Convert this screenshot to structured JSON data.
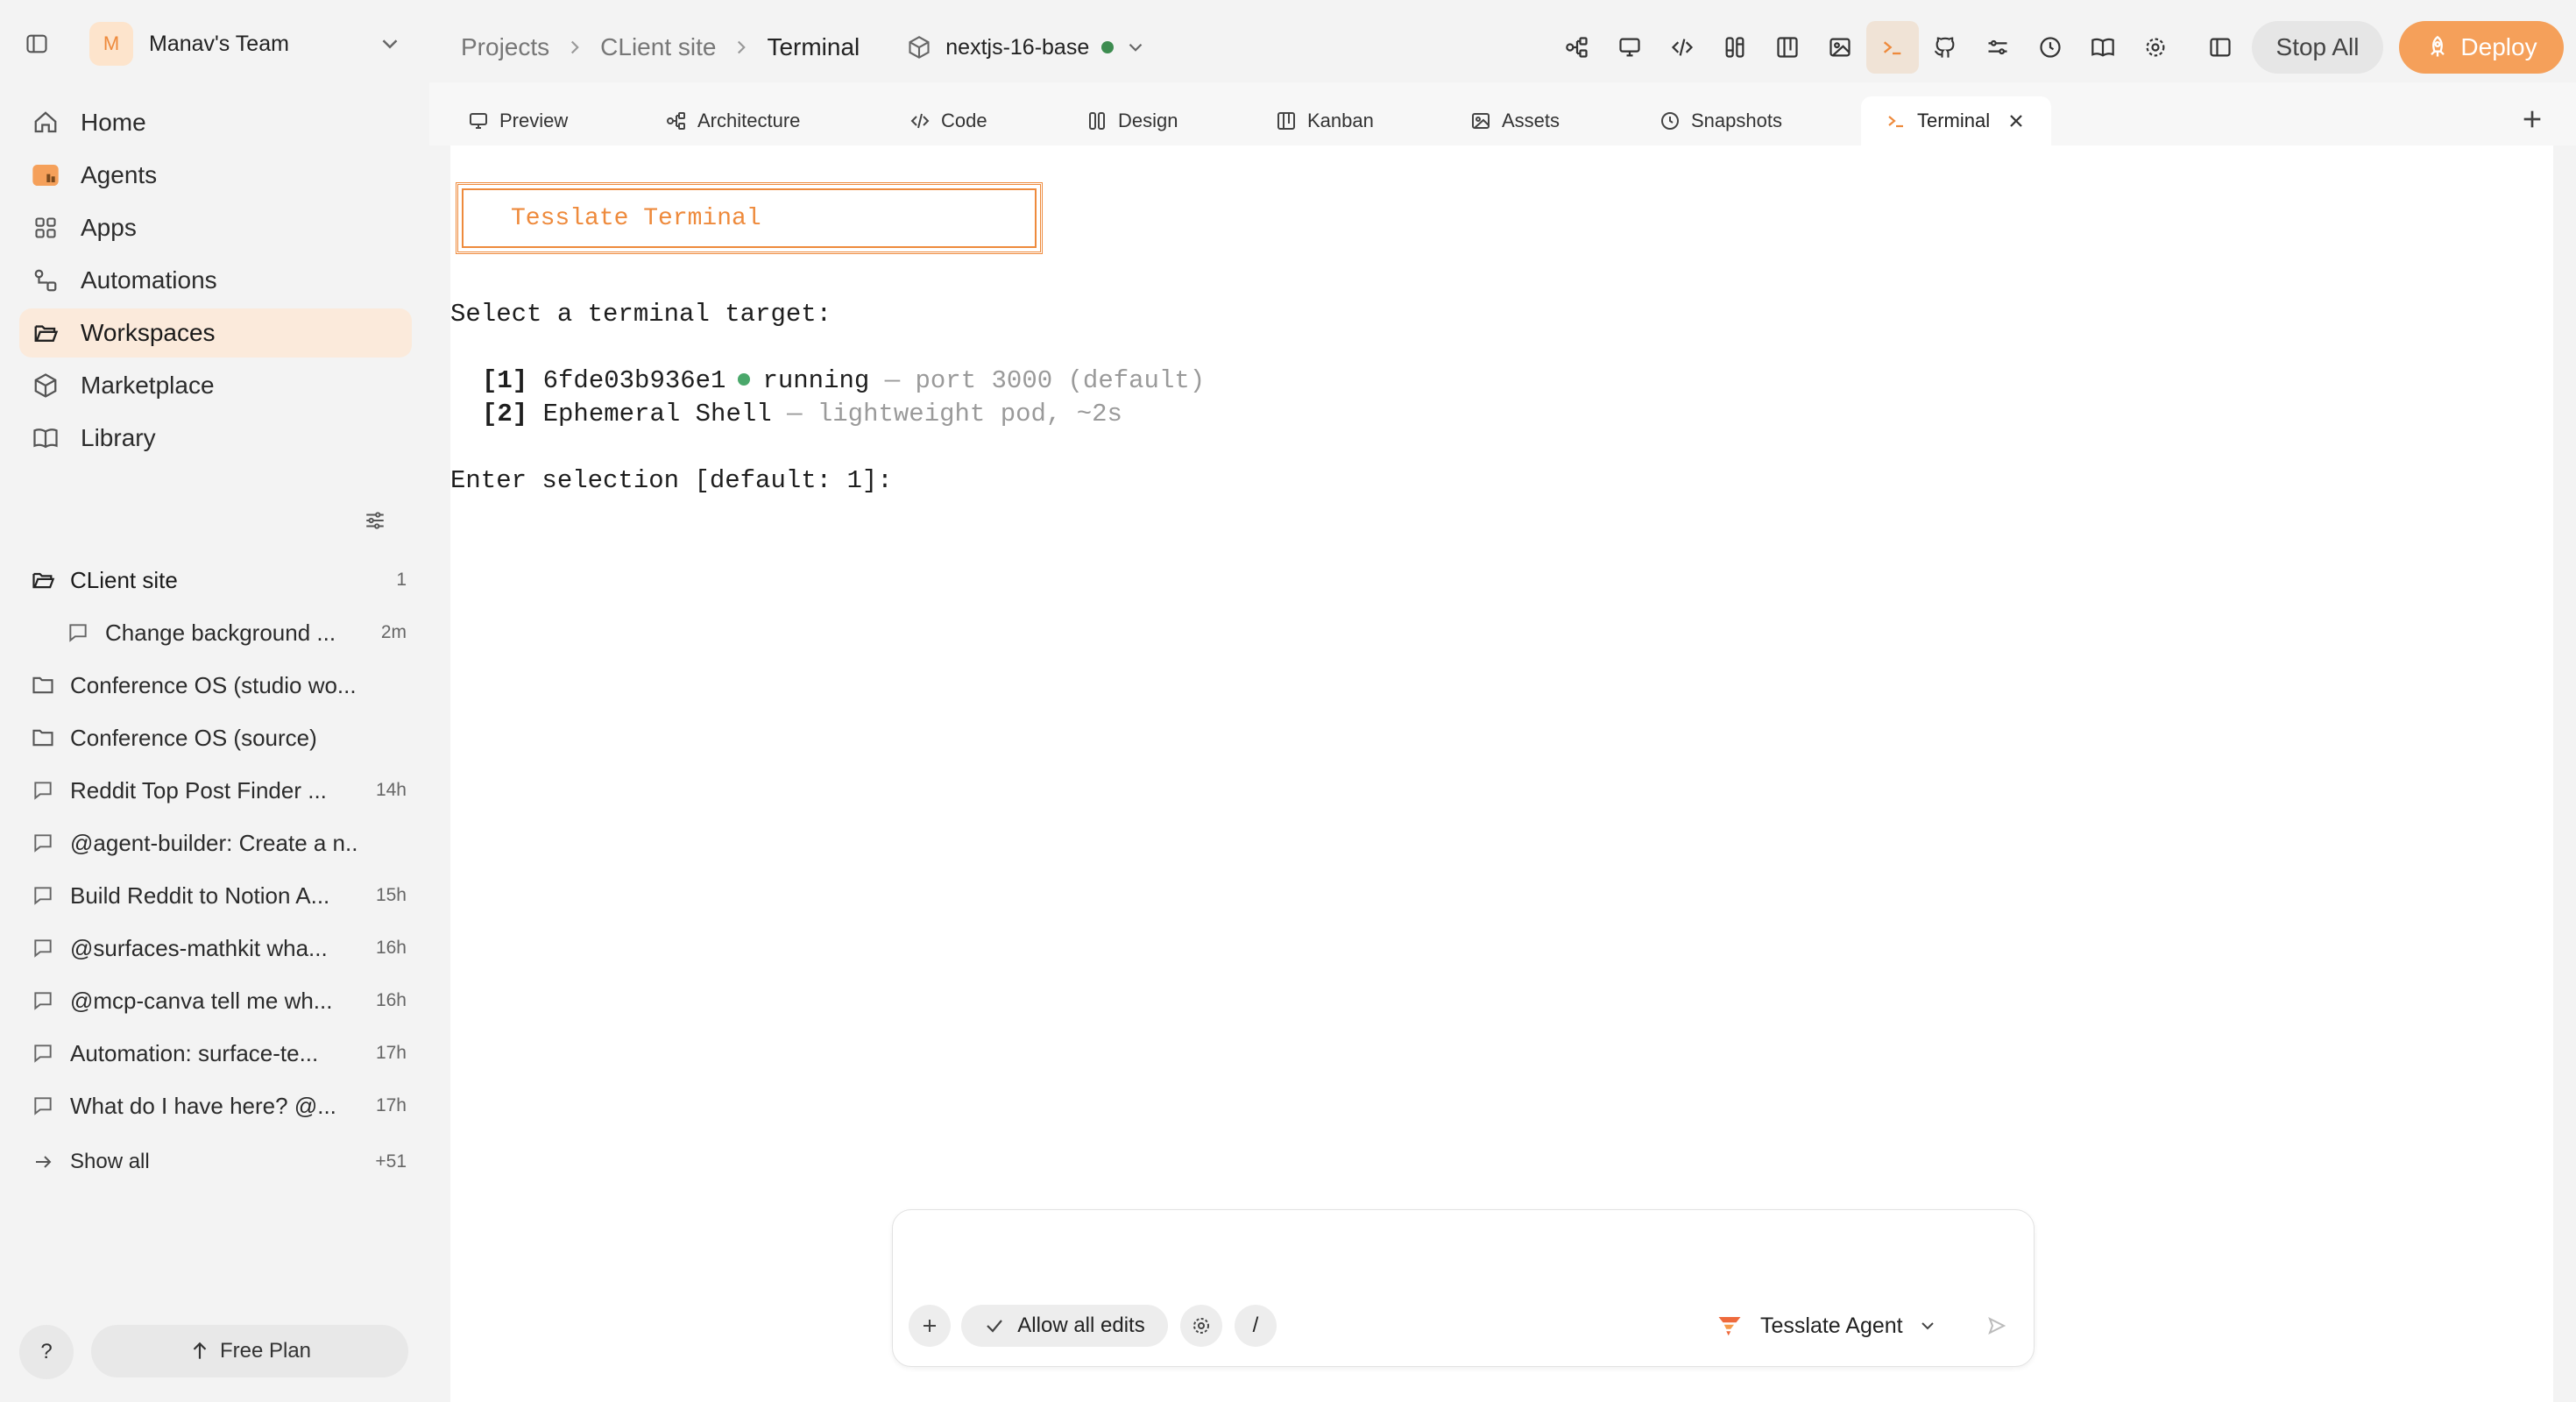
{
  "team": {
    "initial": "M",
    "name": "Manav's Team"
  },
  "nav": [
    {
      "label": "Home",
      "icon": "home-icon"
    },
    {
      "label": "Agents",
      "icon": "agents-icon"
    },
    {
      "label": "Apps",
      "icon": "apps-icon"
    },
    {
      "label": "Automations",
      "icon": "automations-icon"
    },
    {
      "label": "Workspaces",
      "icon": "folder-open-icon",
      "active": true
    },
    {
      "label": "Marketplace",
      "icon": "cube-icon"
    },
    {
      "label": "Library",
      "icon": "book-icon"
    }
  ],
  "threads": [
    {
      "title": "CLient site",
      "time": "1",
      "icon": "folder-open-icon"
    },
    {
      "title": "Change background ...",
      "time": "2m",
      "icon": "chat-icon"
    },
    {
      "title": "Conference OS (studio wo...",
      "time": "",
      "icon": "folder-icon"
    },
    {
      "title": "Conference OS (source)",
      "time": "",
      "icon": "folder-icon"
    },
    {
      "title": "Reddit Top Post Finder ...",
      "time": "14h",
      "icon": "chat-icon"
    },
    {
      "title": "@agent-builder: Create a n...",
      "time": "",
      "icon": "chat-icon"
    },
    {
      "title": "Build Reddit to Notion A...",
      "time": "15h",
      "icon": "chat-icon"
    },
    {
      "title": "@surfaces-mathkit wha...",
      "time": "16h",
      "icon": "chat-icon"
    },
    {
      "title": "@mcp-canva tell me wh...",
      "time": "16h",
      "icon": "chat-icon"
    },
    {
      "title": "Automation: surface-te...",
      "time": "17h",
      "icon": "chat-icon"
    },
    {
      "title": "What do I have here? @...",
      "time": "17h",
      "icon": "chat-icon"
    }
  ],
  "show_all": {
    "label": "Show all",
    "count": "+51"
  },
  "help_label": "?",
  "plan_label": "Free Plan",
  "breadcrumb": {
    "projects": "Projects",
    "project": "CLient site",
    "current": "Terminal"
  },
  "environment": {
    "name": "nextjs-16-base",
    "status_color": "#3d8c50"
  },
  "actions": {
    "stop_all": "Stop All",
    "deploy": "Deploy"
  },
  "accent_color": "#ee8a3c",
  "tabs": [
    {
      "label": "Preview",
      "icon": "monitor-icon"
    },
    {
      "label": "Architecture",
      "icon": "architecture-icon"
    },
    {
      "label": "Code",
      "icon": "code-icon"
    },
    {
      "label": "Design",
      "icon": "design-icon"
    },
    {
      "label": "Kanban",
      "icon": "kanban-icon"
    },
    {
      "label": "Assets",
      "icon": "image-icon"
    },
    {
      "label": "Snapshots",
      "icon": "clock-icon"
    },
    {
      "label": "Terminal",
      "icon": "terminal-icon",
      "active": true
    }
  ],
  "terminal": {
    "banner": "Tesslate Terminal",
    "prompt": "Select a terminal target:",
    "option1": {
      "key": "[1]",
      "id": "6fde03b936e1",
      "status": "running",
      "detail": " — port 3000 (default)"
    },
    "option2": {
      "key": "[2]",
      "name": "Ephemeral Shell",
      "detail": " — lightweight pod, ~2s"
    },
    "selection": "Enter selection [default: 1]:"
  },
  "chat": {
    "allow_edits": "Allow all edits",
    "slash": "/",
    "agent": "Tesslate Agent"
  }
}
